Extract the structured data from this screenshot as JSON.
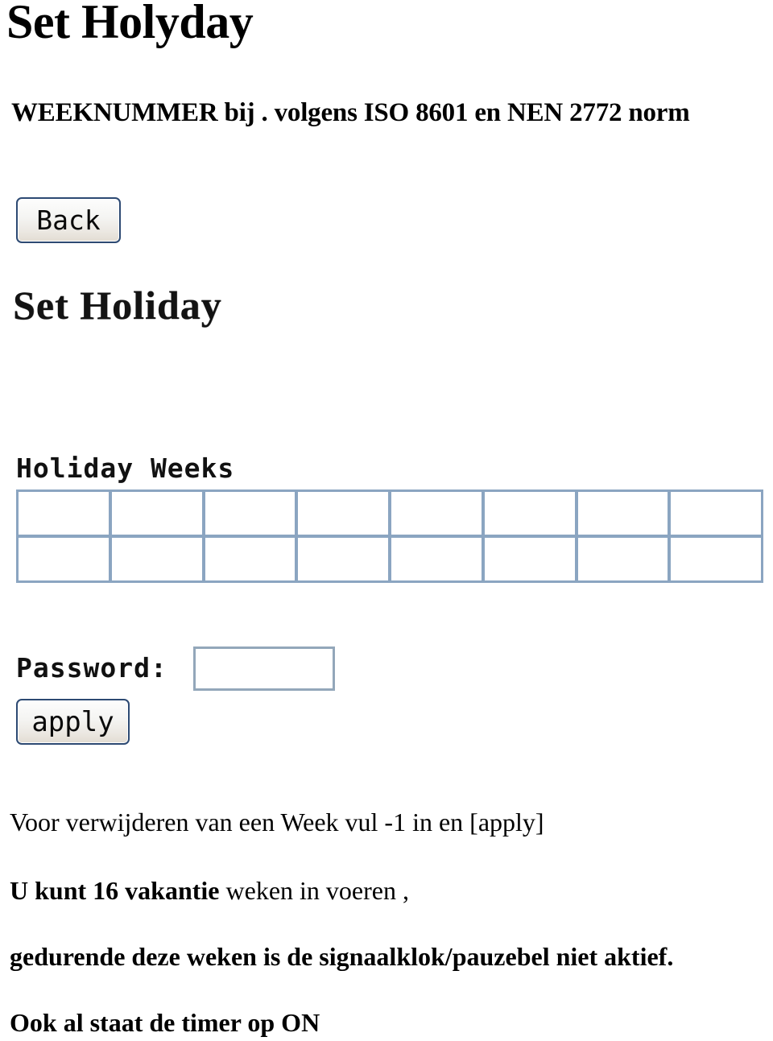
{
  "document": {
    "title": "Set Holyday",
    "subtitle": "WEEKNUMMER bij . volgens ISO 8601 en NEN 2772 norm"
  },
  "screen": {
    "back_button_label": "Back",
    "heading": "Set Holiday",
    "holiday_weeks_label": "Holiday Weeks",
    "weeks": {
      "count": 16,
      "columns": 8,
      "rows": 2,
      "values": [
        "",
        "",
        "",
        "",
        "",
        "",
        "",
        "",
        "",
        "",
        "",
        "",
        "",
        "",
        "",
        ""
      ],
      "placeholder": ""
    },
    "password": {
      "label": "Password:",
      "value": "",
      "placeholder": ""
    },
    "apply_button_label": "apply"
  },
  "notes": {
    "delete_hint": "Voor verwijderen van een Week vul -1 in en [apply]",
    "capacity_bold": "U kunt  16 vakantie",
    "capacity_rest": " weken in voeren ,",
    "inactive": "gedurende deze weken is de signaalklok/pauzebel niet aktief.",
    "timer": "Ook al staat de timer op ON"
  },
  "colors": {
    "grid_border": "#8ba5c1",
    "input_border": "#93a7ba",
    "button_border": "#2d4a73",
    "text": "#000000"
  }
}
